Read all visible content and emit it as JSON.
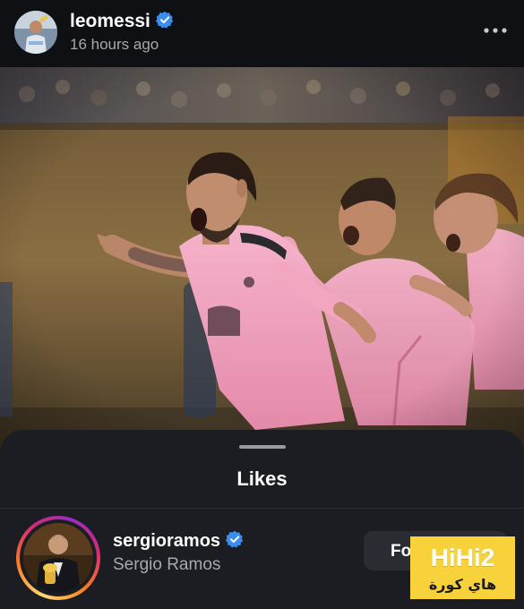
{
  "post": {
    "username": "leomessi",
    "time": "16 hours ago"
  },
  "icons": {
    "verified": "verified-badge-icon",
    "more": "more-options-icon"
  },
  "likes_sheet": {
    "title": "Likes",
    "user": {
      "username": "sergioramos",
      "full_name": "Sergio Ramos",
      "follow_label": "Fo"
    }
  },
  "watermark": {
    "latin": "HiHi2",
    "arabic": "هاي كورة"
  },
  "colors": {
    "background": "#0f1014",
    "sheet": "#1c1d22",
    "verified_blue": "#3b8ef0",
    "jersey_pink": "#f3a6c0",
    "watermark_yellow": "#f7d23b"
  }
}
